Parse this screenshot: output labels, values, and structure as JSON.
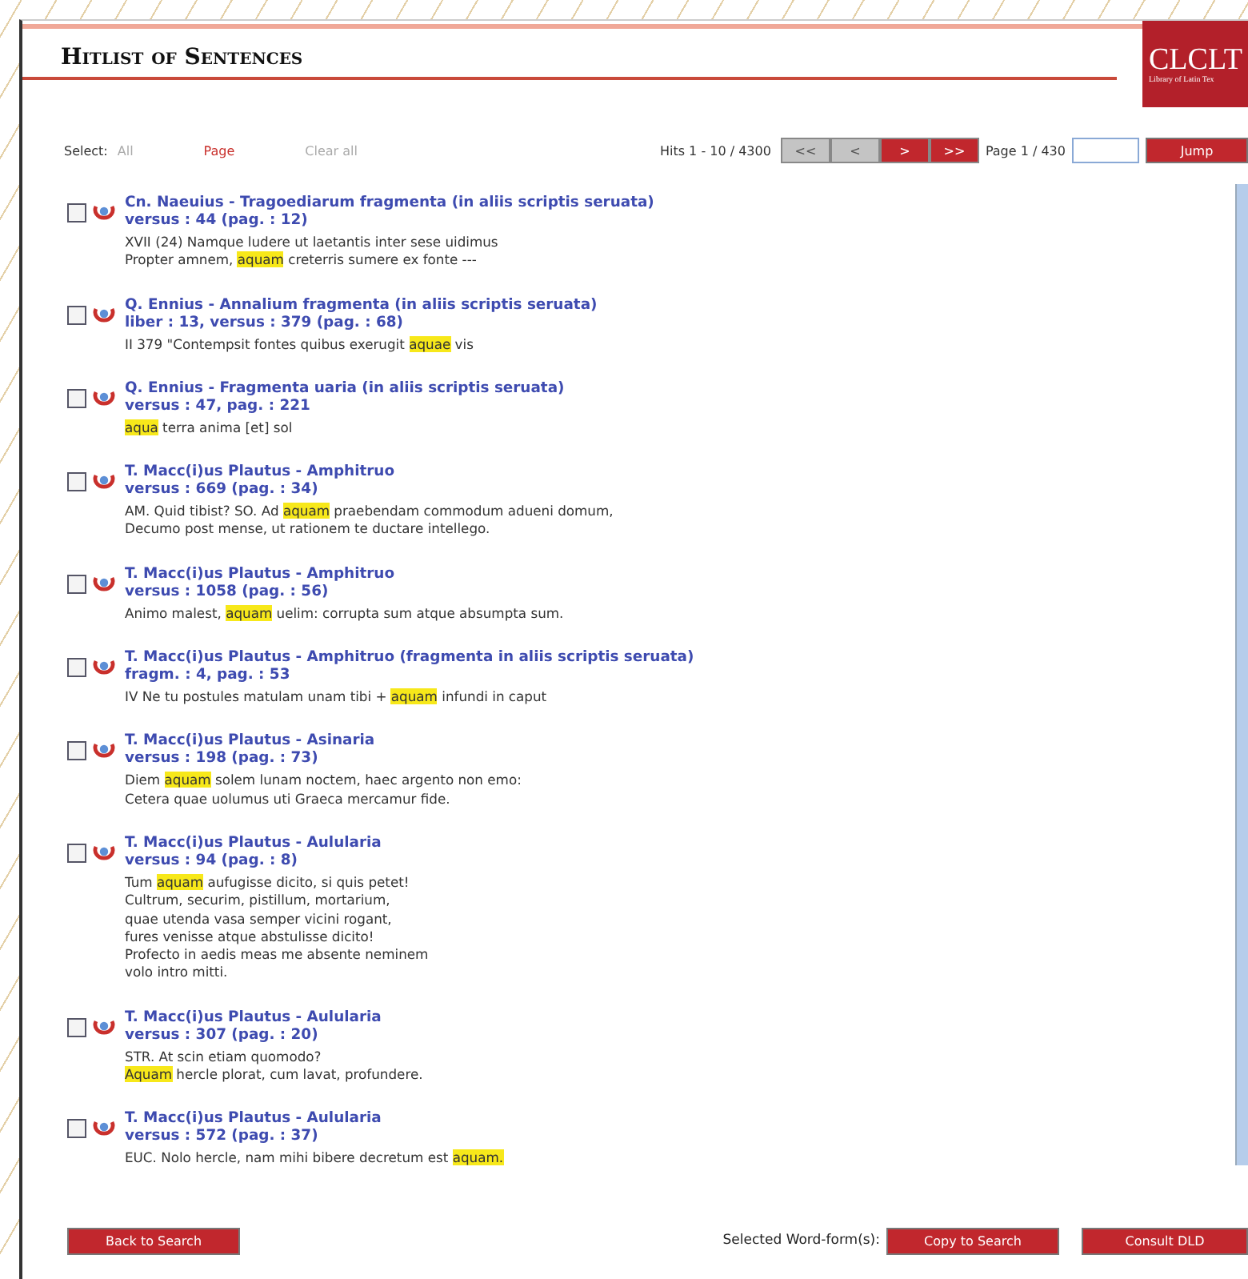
{
  "header": {
    "title": "Hitlist of Sentences",
    "logo": "CLCLT",
    "logo_subtitle": "Library of Latin Tex"
  },
  "select": {
    "label": "Select:",
    "options": [
      {
        "label": "All",
        "selected": false
      },
      {
        "label": "Page",
        "selected": true
      },
      {
        "label": "Clear all",
        "selected": false
      }
    ]
  },
  "pager": {
    "hits": "Hits 1 - 10 / 4300",
    "buttons": [
      {
        "label": "<<",
        "disabled": true
      },
      {
        "label": "<",
        "disabled": true
      },
      {
        "label": ">",
        "disabled": false
      },
      {
        "label": ">>",
        "disabled": false
      }
    ],
    "page": "Page 1 / 430",
    "jump": "Jump"
  },
  "results": [
    {
      "checked": false,
      "title": "Cn. Naeuius - Tragoediarum fragmenta (in aliis scriptis seruata)",
      "reference": "versus : 44 (pag. : 12)",
      "lines": [
        [
          {
            "text": "XVII (24) Namque ludere ut laetantis inter sese uidimus",
            "highlight": false
          }
        ],
        [
          {
            "text": "Propter amnem, ",
            "highlight": false
          },
          {
            "text": "aquam",
            "highlight": true
          },
          {
            "text": " creterris sumere ex fonte ---",
            "highlight": false
          }
        ]
      ]
    },
    {
      "checked": false,
      "title": "Q. Ennius - Annalium fragmenta (in aliis scriptis seruata)",
      "reference": "liber : 13, versus : 379 (pag. : 68)",
      "lines": [
        [
          {
            "text": "II 379 \"Contempsit fontes quibus exerugit ",
            "highlight": false
          },
          {
            "text": "aquae",
            "highlight": true
          },
          {
            "text": " vis",
            "highlight": false
          }
        ]
      ]
    },
    {
      "checked": false,
      "title": "Q. Ennius - Fragmenta uaria (in aliis scriptis seruata)",
      "reference": "versus : 47, pag. : 221",
      "lines": [
        [
          {
            "text": "aqua",
            "highlight": true
          },
          {
            "text": " terra anima [et] sol",
            "highlight": false
          }
        ]
      ]
    },
    {
      "checked": false,
      "title": "T. Macc(i)us Plautus - Amphitruo",
      "reference": "versus : 669 (pag. : 34)",
      "lines": [
        [
          {
            "text": "AM. Quid tibist? SO. Ad ",
            "highlight": false
          },
          {
            "text": "aquam",
            "highlight": true
          },
          {
            "text": " praebendam commodum adueni domum,",
            "highlight": false
          }
        ],
        [
          {
            "text": "Decumo post mense, ut rationem te ductare intellego.",
            "highlight": false
          }
        ]
      ]
    },
    {
      "checked": false,
      "title": "T. Macc(i)us Plautus - Amphitruo",
      "reference": "versus : 1058 (pag. : 56)",
      "lines": [
        [
          {
            "text": "Animo malest, ",
            "highlight": false
          },
          {
            "text": "aquam",
            "highlight": true
          },
          {
            "text": " uelim: corrupta sum atque absumpta sum.",
            "highlight": false
          }
        ]
      ]
    },
    {
      "checked": false,
      "title": "T. Macc(i)us Plautus - Amphitruo (fragmenta in aliis scriptis seruata)",
      "reference": "fragm. : 4, pag. : 53",
      "lines": [
        [
          {
            "text": "IV Ne tu postules matulam unam tibi + ",
            "highlight": false
          },
          {
            "text": "aquam",
            "highlight": true
          },
          {
            "text": " infundi in caput",
            "highlight": false
          }
        ]
      ]
    },
    {
      "checked": false,
      "title": "T. Macc(i)us Plautus - Asinaria",
      "reference": "versus : 198 (pag. : 73)",
      "lines": [
        [
          {
            "text": "Diem ",
            "highlight": false
          },
          {
            "text": "aquam",
            "highlight": true
          },
          {
            "text": " solem lunam noctem, haec argento non emo:",
            "highlight": false
          }
        ],
        [
          {
            "text": "Cetera quae uolumus uti Graeca mercamur fide.",
            "highlight": false
          }
        ]
      ]
    },
    {
      "checked": false,
      "title": "T. Macc(i)us Plautus - Aulularia",
      "reference": "versus : 94 (pag. : 8)",
      "lines": [
        [
          {
            "text": "Tum ",
            "highlight": false
          },
          {
            "text": "aquam",
            "highlight": true
          },
          {
            "text": " aufugisse dicito, si quis petet!",
            "highlight": false
          }
        ],
        [
          {
            "text": "Cultrum, securim, pistillum, mortarium,",
            "highlight": false
          }
        ],
        [
          {
            "text": "quae utenda vasa semper vicini rogant,",
            "highlight": false
          }
        ],
        [
          {
            "text": "fures venisse atque abstulisse dicito!",
            "highlight": false
          }
        ],
        [
          {
            "text": "Profecto in aedis meas me absente neminem",
            "highlight": false
          }
        ],
        [
          {
            "text": "volo intro mitti.",
            "highlight": false
          }
        ]
      ]
    },
    {
      "checked": false,
      "title": "T. Macc(i)us Plautus - Aulularia",
      "reference": "versus : 307 (pag. : 20)",
      "lines": [
        [
          {
            "text": "STR. At scin etiam quomodo?",
            "highlight": false
          }
        ],
        [
          {
            "text": "Aquam",
            "highlight": true
          },
          {
            "text": " hercle plorat, cum lavat, profundere.",
            "highlight": false
          }
        ]
      ]
    },
    {
      "checked": false,
      "title": "T. Macc(i)us Plautus - Aulularia",
      "reference": "versus : 572 (pag. : 37)",
      "lines": [
        [
          {
            "text": "EUC. Nolo hercle, nam mihi bibere decretum est ",
            "highlight": false
          },
          {
            "text": "aquam.",
            "highlight": true
          }
        ]
      ]
    }
  ],
  "footer": {
    "back": "Back to Search",
    "selected_label": "Selected Word-form(s):",
    "copy": "Copy to Search",
    "consult": "Consult DLD"
  }
}
